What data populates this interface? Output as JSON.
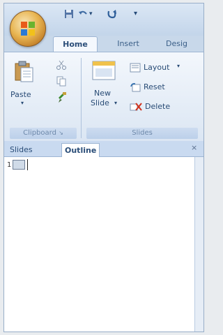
{
  "qat": {
    "save_icon": "save-icon",
    "undo_icon": "undo-icon",
    "redo_icon": "redo-icon"
  },
  "tabs": [
    {
      "label": "Home"
    },
    {
      "label": "Insert"
    },
    {
      "label": "Desig"
    }
  ],
  "ribbon": {
    "clipboard": {
      "paste_label": "Paste",
      "group_label": "Clipboard"
    },
    "slides": {
      "new_slide_line1": "New",
      "new_slide_line2": "Slide",
      "layout_label": "Layout",
      "reset_label": "Reset",
      "delete_label": "Delete",
      "group_label": "Slides"
    }
  },
  "pane": {
    "tabs": [
      {
        "label": "Slides"
      },
      {
        "label": "Outline"
      }
    ],
    "slide_number": "1"
  },
  "colors": {
    "ribbon_bg": "#dbe6f3",
    "tab_active": "#f4f8fd",
    "accent": "#2a4d78"
  }
}
